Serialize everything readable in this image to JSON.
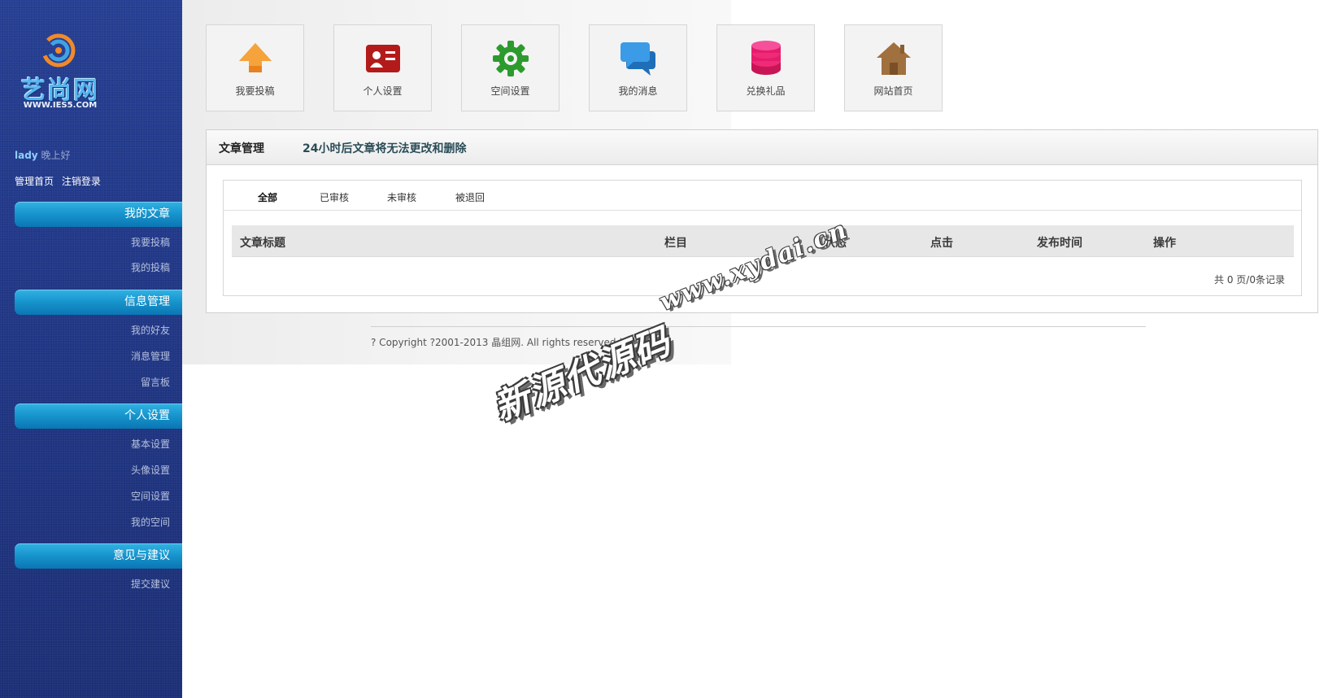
{
  "brand": {
    "logo_text": "艺尚网",
    "logo_url": "WWW.IES5.COM"
  },
  "user": {
    "name": "lady",
    "greeting": "晚上好",
    "links": [
      "管理首页",
      "注销登录"
    ]
  },
  "sidebar": {
    "sections": [
      {
        "title": "我的文章",
        "items": [
          "我要投稿",
          "我的投稿"
        ]
      },
      {
        "title": "信息管理",
        "items": [
          "我的好友",
          "消息管理",
          "留言板"
        ]
      },
      {
        "title": "个人设置",
        "items": [
          "基本设置",
          "头像设置",
          "空间设置",
          "我的空间"
        ]
      },
      {
        "title": "意见与建议",
        "items": [
          "提交建议"
        ]
      }
    ]
  },
  "shortcuts": [
    {
      "label": "我要投稿",
      "icon": "upload-arrow-icon",
      "color": "#e8821f"
    },
    {
      "label": "个人设置",
      "icon": "id-card-icon",
      "color": "#b31b1b"
    },
    {
      "label": "空间设置",
      "icon": "gear-icon",
      "color": "#2d9a2d"
    },
    {
      "label": "我的消息",
      "icon": "chat-bubbles-icon",
      "color": "#2b8ad8"
    },
    {
      "label": "兑换礼品",
      "icon": "coins-stack-icon",
      "color": "#e51c6b"
    },
    {
      "label": "网站首页",
      "icon": "house-icon",
      "color": "#a0703e"
    }
  ],
  "panel": {
    "title": "文章管理",
    "note": "24小时后文章将无法更改和删除",
    "tabs": [
      "全部",
      "已审核",
      "未审核",
      "被退回"
    ],
    "active_tab": "全部",
    "columns": [
      "文章标题",
      "栏目",
      "状态",
      "点击",
      "发布时间",
      "操作"
    ],
    "rows": [],
    "pager": "共 0 页/0条记录"
  },
  "footer": {
    "copyright": "? Copyright ?2001-2013 晶组网. All rights reserved | T"
  },
  "watermark": {
    "url": "www.xydai.cn",
    "name": "新源代源码"
  }
}
